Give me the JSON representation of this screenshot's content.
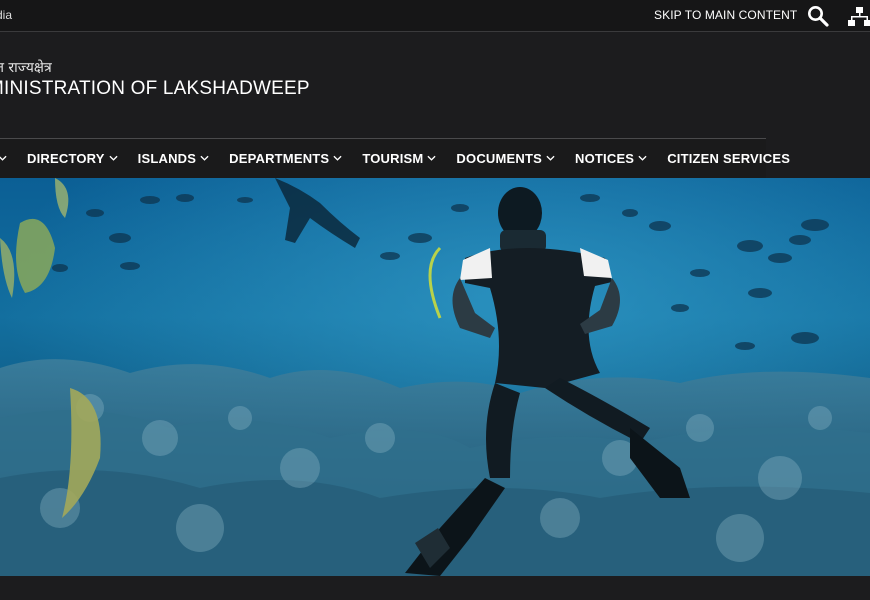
{
  "topbar": {
    "gov_text": "dia",
    "skip_label": "SKIP TO MAIN CONTENT",
    "search_icon": "search-icon",
    "sitemap_icon": "sitemap-icon"
  },
  "header": {
    "hindi_name": "त राज्यक्षेत्र",
    "title": "MINISTRATION OF LAKSHADWEEP"
  },
  "nav": {
    "items": [
      {
        "label": ""
      },
      {
        "label": "DIRECTORY"
      },
      {
        "label": "ISLANDS"
      },
      {
        "label": "DEPARTMENTS"
      },
      {
        "label": "TOURISM"
      },
      {
        "label": "DOCUMENTS"
      },
      {
        "label": "NOTICES"
      },
      {
        "label": "CITIZEN SERVICES"
      }
    ]
  },
  "hero": {
    "subject": "scuba diver underwater with fish"
  },
  "colors": {
    "background": "#1c1c1e",
    "ocean_deep": "#0a4a78",
    "ocean_light": "#1b86b8"
  }
}
